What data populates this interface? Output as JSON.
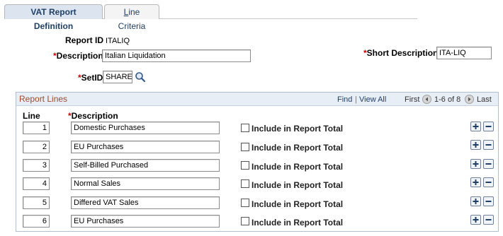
{
  "tabs": [
    {
      "label": "VAT Report Definition",
      "active": true
    },
    {
      "label_access_key": "L",
      "label_rest": "ine Criteria",
      "active": false
    }
  ],
  "form": {
    "report_id_label": "Report ID",
    "report_id_value": "ITALIQ",
    "description_label": "Description",
    "description_value": "Italian Liquidation",
    "short_description_label": "Short Description",
    "short_description_value": "ITA-LIQ",
    "setid_label": "SetID",
    "setid_value": "SHARE",
    "required_marker": "*"
  },
  "grid": {
    "title": "Report Lines",
    "find": "Find",
    "sep": "|",
    "view_all": "View All",
    "first": "First",
    "range": "1-6 of 8",
    "last": "Last",
    "col_line": "Line",
    "col_description": "Description",
    "checkbox_label": "Include in Report Total",
    "rows": [
      {
        "line": "1",
        "description": "Domestic Purchases",
        "include": false
      },
      {
        "line": "2",
        "description": "EU Purchases",
        "include": false
      },
      {
        "line": "3",
        "description": "Self-Billed Purchased",
        "include": false
      },
      {
        "line": "4",
        "description": "Normal Sales",
        "include": false
      },
      {
        "line": "5",
        "description": "Differed VAT Sales",
        "include": false
      },
      {
        "line": "6",
        "description": "EU Purchases",
        "include": false
      }
    ]
  },
  "colors": {
    "tab_active_bg": "#dbe4ef",
    "grid_title": "#9c4a2b",
    "link": "#1f3f66",
    "required": "#c00000"
  },
  "icons": {
    "lookup": "magnifier-icon",
    "prev": "arrow-left-icon",
    "next": "arrow-right-icon",
    "add": "plus-icon",
    "delete": "minus-icon"
  }
}
